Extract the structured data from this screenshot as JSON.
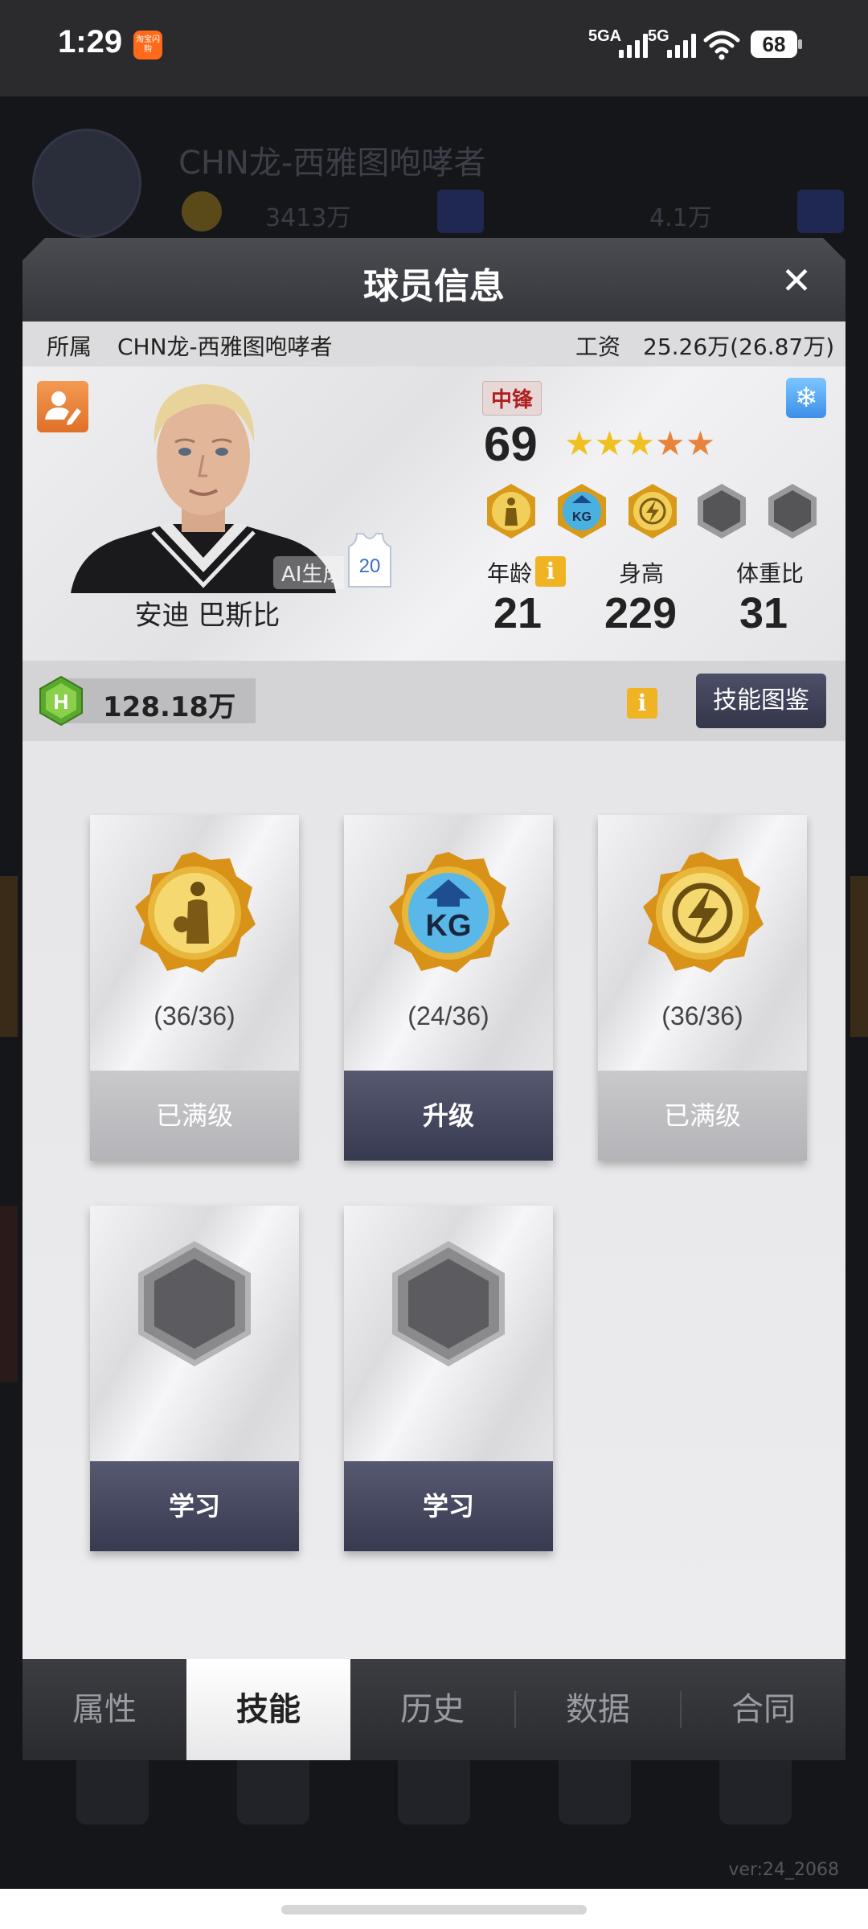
{
  "status_bar": {
    "time": "1:29",
    "app_icon_text": "淘宝闪购",
    "network_1": "5GA",
    "network_2": "5G",
    "battery": "68"
  },
  "background": {
    "team_name": "CHN龙-西雅图咆哮者",
    "coin_value": "3413万",
    "gem_value": "4.1万",
    "version": "ver:24_2068"
  },
  "modal": {
    "title": "球员信息",
    "close_icon": "close-icon",
    "team_label": "所属",
    "team_value": "CHN龙-西雅图咆哮者",
    "salary_label": "工资",
    "salary_value": "25.26万(26.87万)"
  },
  "player": {
    "name": "安迪 巴斯比",
    "ai_tag": "AI生成",
    "jersey_number": "20",
    "position": "中锋",
    "rating": "69",
    "stars": {
      "total": 5,
      "gold": 3,
      "orange": 2
    },
    "age_label": "年龄",
    "age": "21",
    "height_label": "身高",
    "height": "229",
    "weight_label": "体重比",
    "weight": "31",
    "info_icon_text": "i"
  },
  "currency": {
    "points": "128.18万",
    "info_icon_text": "i",
    "codex_button": "技能图鉴"
  },
  "skills": [
    {
      "icon": "post-player-skill-icon",
      "level": "(36/36)",
      "button": "已满级",
      "state": "maxed"
    },
    {
      "icon": "kg-skill-icon",
      "level": "(24/36)",
      "button": "升级",
      "state": "upgrade"
    },
    {
      "icon": "lightning-skill-icon",
      "level": "(36/36)",
      "button": "已满级",
      "state": "maxed"
    },
    {
      "icon": "empty-hex-slot-icon",
      "level": "",
      "button": "学习",
      "state": "learn"
    },
    {
      "icon": "empty-hex-slot-icon",
      "level": "",
      "button": "学习",
      "state": "learn"
    }
  ],
  "tabs": [
    {
      "label": "属性"
    },
    {
      "label": "技能",
      "active": true
    },
    {
      "label": "历史"
    },
    {
      "label": "数据"
    },
    {
      "label": "合同"
    }
  ],
  "colors": {
    "gold": "#e8b830",
    "accent_dark": "#3a3d54",
    "position_red": "#b02020",
    "info_yellow": "#f0b323"
  }
}
